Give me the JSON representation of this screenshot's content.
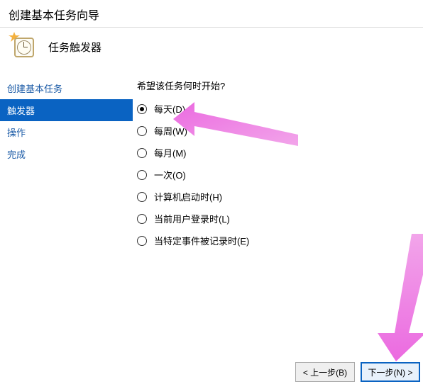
{
  "wizard": {
    "window_title": "创建基本任务向导",
    "section_title": "任务触发器"
  },
  "sidebar": {
    "items": [
      {
        "label": "创建基本任务",
        "selected": false
      },
      {
        "label": "触发器",
        "selected": true
      },
      {
        "label": "操作",
        "selected": false
      },
      {
        "label": "完成",
        "selected": false
      }
    ]
  },
  "main": {
    "question": "希望该任务何时开始?",
    "options": [
      {
        "label": "每天(D)",
        "checked": true
      },
      {
        "label": "每周(W)",
        "checked": false
      },
      {
        "label": "每月(M)",
        "checked": false
      },
      {
        "label": "一次(O)",
        "checked": false
      },
      {
        "label": "计算机启动时(H)",
        "checked": false
      },
      {
        "label": "当前用户登录时(L)",
        "checked": false
      },
      {
        "label": "当特定事件被记录时(E)",
        "checked": false
      }
    ]
  },
  "footer": {
    "back_label": "< 上一步(B)",
    "next_label": "下一步(N) >"
  },
  "annotations": {
    "arrow1_color": "#eb6ae0",
    "arrow2_color": "#eb6ae0"
  }
}
